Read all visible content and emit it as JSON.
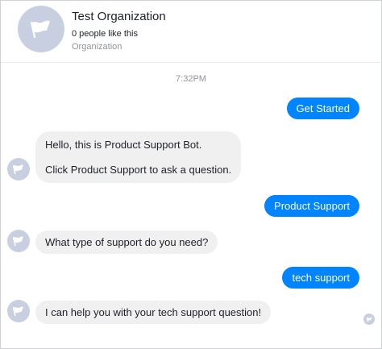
{
  "header": {
    "page_name": "Test Organization",
    "likes": "0 people like this",
    "category": "Organization"
  },
  "conversation": {
    "timestamp": "7:32PM",
    "messages": [
      {
        "from": "user",
        "text": "Get Started"
      },
      {
        "from": "bot",
        "lines": [
          "Hello, this is Product Support Bot.",
          "Click Product Support to ask a question."
        ]
      },
      {
        "from": "user",
        "text": "Product Support"
      },
      {
        "from": "bot",
        "text": "What type of support do you need?"
      },
      {
        "from": "user",
        "text": "tech support"
      },
      {
        "from": "bot",
        "text": "I can help you with your tech support question!"
      }
    ]
  },
  "colors": {
    "outgoing_bubble": "#0084ff",
    "incoming_bubble": "#f1f0f0",
    "avatar_bg": "#c8cfe0"
  },
  "icons": {
    "page_avatar": "flag-icon",
    "bot_avatar": "flag-icon",
    "seen_indicator": "flag-icon"
  }
}
